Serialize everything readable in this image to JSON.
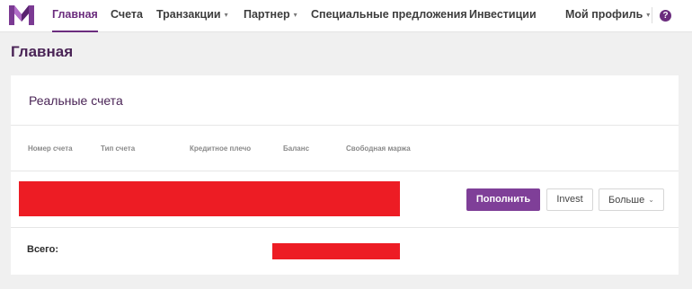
{
  "nav": {
    "items": [
      {
        "label": "Главная",
        "active": true
      },
      {
        "label": "Счета"
      },
      {
        "label": "Транзакции",
        "dropdown": true
      },
      {
        "label": "Партнер",
        "dropdown": true
      },
      {
        "label": "Специальные предложения"
      },
      {
        "label": "Инвестиции"
      }
    ],
    "profile_label": "Мой профиль",
    "help_symbol": "?"
  },
  "page": {
    "title": "Главная"
  },
  "accounts": {
    "title": "Реальные счета",
    "columns": [
      "Номер счета",
      "Тип счета",
      "Кредитное плечо",
      "Баланс",
      "Свободная маржа"
    ],
    "actions": {
      "deposit": "Пополнить",
      "invest": "Invest",
      "more": "Больше"
    },
    "total_label": "Всего:"
  },
  "colors": {
    "brand": "#6b2d7e",
    "button_primary": "#7f3f98",
    "redaction": "#ed1c24"
  }
}
